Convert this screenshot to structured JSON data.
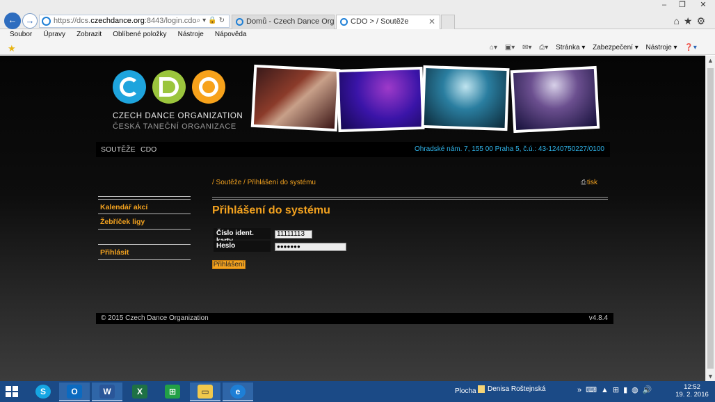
{
  "browser": {
    "url_prefix": "https://dcs.",
    "url_domain": "czechdance.org",
    "url_path": ":8443/login.cdo",
    "tabs": [
      {
        "label": "Domů - Czech Dance Organiza..."
      },
      {
        "label": "CDO > / Soutěže"
      }
    ],
    "menu": [
      "Soubor",
      "Úpravy",
      "Zobrazit",
      "Oblíbené položky",
      "Nástroje",
      "Nápověda"
    ],
    "command_bar": {
      "page": "Stránka ▾",
      "security": "Zabezpečení ▾",
      "tools": "Nástroje ▾"
    }
  },
  "site": {
    "logo_title": "CZECH DANCE ORGANIZATION",
    "logo_subtitle": "ČESKÁ TANEČNÍ ORGANIZACE",
    "nav": [
      "SOUTĚŽE",
      "CDO"
    ],
    "address_info": "Ohradské nám. 7, 155 00 Praha 5, č.ú.: 43-1240750227/0100",
    "breadcrumb": "/ Soutěže / Přihlášení do systému",
    "print_label": "tisk",
    "left_menu": [
      "Kalendář akcí",
      "Žebříček ligy",
      "Přihlásit"
    ],
    "heading": "Přihlášení do systému",
    "form": {
      "card_label": "Číslo ident. karty",
      "card_value": "11111113",
      "password_label": "Heslo",
      "password_value": "●●●●●●●",
      "submit_label": "Přihlášení"
    },
    "footer_copy": "© 2015 Czech Dance Organization",
    "footer_version": "v4.8.4",
    "colors": {
      "accent": "#f3a21f",
      "link_blue": "#2fb3e8",
      "c": "#1ea4dd",
      "d": "#9bc53d",
      "o": "#f7a21b"
    }
  },
  "taskbar": {
    "desktop_label": "Plocha",
    "user_label": "Denisa Roštejnská",
    "time": "12:52",
    "date": "19. 2. 2016"
  }
}
